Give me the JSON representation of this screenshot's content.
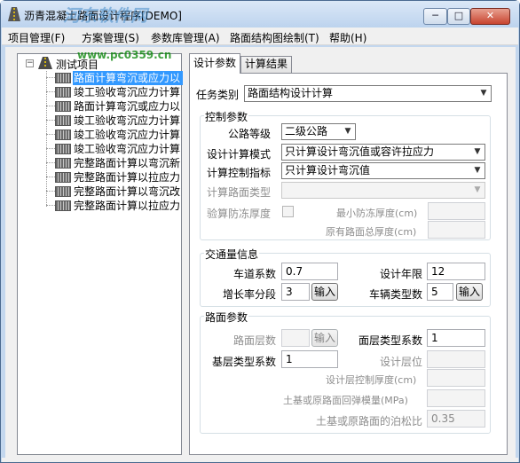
{
  "window": {
    "title": "沥青混凝土路面设计程序[DEMO]",
    "watermark": "河东软件网",
    "watermark_url": "www.pc0359.cn",
    "min_glyph": "─",
    "max_glyph": "□",
    "close_glyph": "✕"
  },
  "menu": {
    "items": [
      "项目管理(F)",
      "方案管理(S)",
      "参数库管理(A)",
      "路面结构图绘制(T)",
      "帮助(H)"
    ]
  },
  "tree": {
    "expander": "−",
    "root_label": "测试项目",
    "items": [
      "路面计算弯沉或应力以",
      "竣工验收弯沉应力计算",
      "路面计算弯沉或应力以",
      "竣工验收弯沉应力计算",
      "竣工验收弯沉应力计算",
      "竣工验收弯沉应力计算",
      "完整路面计算以弯沉新",
      "完整路面计算以拉应力",
      "完整路面计算以弯沉改",
      "完整路面计算以拉应力"
    ],
    "selected_index": 0
  },
  "tabs": {
    "design_params": "设计参数",
    "results": "计算结果"
  },
  "task": {
    "label": "任务类别",
    "value": "路面结构设计计算"
  },
  "control": {
    "title": "控制参数",
    "road_grade_label": "公路等级",
    "road_grade_value": "二级公路",
    "design_mode_label": "设计计算模式",
    "design_mode_value": "只计算设计弯沉值或容许拉应力",
    "control_index_label": "计算控制指标",
    "control_index_value": "只计算设计弯沉值",
    "pavement_type_label": "计算路面类型",
    "pavement_type_value": "",
    "frost_check_label": "验算防冻厚度",
    "min_frost_label": "最小防冻厚度(cm)",
    "min_frost_value": "",
    "orig_thickness_label": "原有路面总厚度(cm)",
    "orig_thickness_value": ""
  },
  "traffic": {
    "title": "交通量信息",
    "lane_coef_label": "车道系数",
    "lane_coef_value": "0.7",
    "design_years_label": "设计年限",
    "design_years_value": "12",
    "growth_seg_label": "增长率分段",
    "growth_seg_value": "3",
    "input_btn": "输入",
    "vehicle_types_label": "车辆类型数",
    "vehicle_types_value": "5",
    "input_btn2": "输入"
  },
  "pavement": {
    "title": "路面参数",
    "layers_label": "路面层数",
    "layers_value": "",
    "input_btn": "输入",
    "surface_type_label": "面层类型系数",
    "surface_type_value": "1",
    "base_type_label": "基层类型系数",
    "base_type_value": "1",
    "design_layer_label": "设计层位",
    "design_layer_value": "",
    "design_layer_thk_label": "设计层控制厚度(cm)",
    "design_layer_thk_value": "",
    "modulus_label": "土基或原路面回弹模量(MPa)",
    "modulus_value": "",
    "poisson_label": "土基或原路面的泊松比",
    "poisson_value": "0.35"
  }
}
